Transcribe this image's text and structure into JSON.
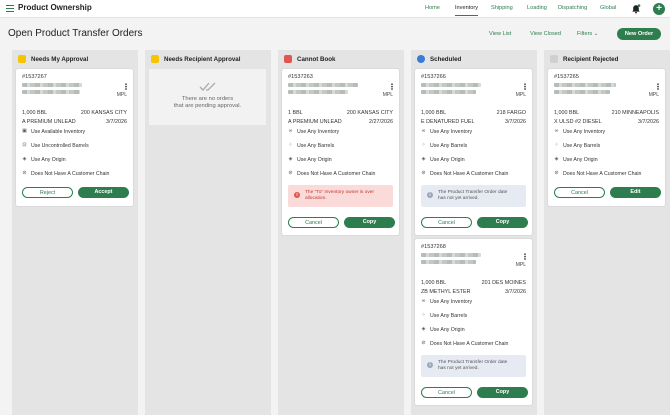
{
  "header": {
    "app_title": "Product Ownership",
    "nav": [
      "Home",
      "Inventory",
      "Shipping",
      "Loading",
      "Dispatching",
      "Global"
    ],
    "active_nav": "Inventory"
  },
  "page": {
    "title": "Open Product Transfer Orders",
    "view_list": "View List",
    "view_closed": "View Closed",
    "filters": "Filters",
    "new_order": "New Order"
  },
  "columns": {
    "needs_my_approval": {
      "title": "Needs My Approval",
      "cards": [
        {
          "order": "#1537267",
          "mpl": "MPL",
          "qty": "1,000 BBL",
          "dest": "200 KANSAS CITY",
          "product": "A PREMIUM UNLEAD",
          "date": "3/7/2026",
          "options": [
            "Use Available Inventory",
            "Use Uncontrolled Barrels",
            "Use Any Origin",
            "Does Not Have A Customer Chain"
          ],
          "btn_left": "Reject",
          "btn_right": "Accept"
        }
      ]
    },
    "needs_recipient_approval": {
      "title": "Needs Recipient Approval",
      "empty_line1": "There are no orders",
      "empty_line2": "that are pending approval."
    },
    "cannot_book": {
      "title": "Cannot Book",
      "cards": [
        {
          "order": "#1537263",
          "mpl": "MPL",
          "qty": "1 BBL",
          "dest": "200 KANSAS CITY",
          "product": "A PREMIUM UNLEAD",
          "date": "2/27/2026",
          "options": [
            "Use Any Inventory",
            "Use Any Barrels",
            "Use Any Origin",
            "Does Not Have A Customer Chain"
          ],
          "alert_line1": "The \"To\" Inventory owner is over",
          "alert_line2": "allocation.",
          "btn_left": "Cancel",
          "btn_right": "Copy"
        }
      ]
    },
    "scheduled": {
      "title": "Scheduled",
      "cards": [
        {
          "order": "#1537266",
          "mpl": "MPL",
          "qty": "1,000 BBL",
          "dest": "218 FARGO",
          "product": "E DENATURED FUEL",
          "date": "3/7/2026",
          "options": [
            "Use Any Inventory",
            "Use Any Barrels",
            "Use Any Origin",
            "Does Not Have A Customer Chain"
          ],
          "alert_line1": "The Product Transfer Order date",
          "alert_line2": "has not yet arrived.",
          "btn_left": "Cancel",
          "btn_right": "Copy"
        },
        {
          "order": "#1537268",
          "mpl": "MPL",
          "qty": "1,000 BBL",
          "dest": "201 DES MOINES",
          "product": "ZB METHYL ESTER",
          "date": "3/7/2026",
          "options": [
            "Use Any Inventory",
            "Use Any Barrels",
            "Use Any Origin",
            "Does Not Have A Customer Chain"
          ],
          "alert_line1": "The Product Transfer Order date",
          "alert_line2": "has not yet arrived.",
          "btn_left": "Cancel",
          "btn_right": "Copy"
        }
      ]
    },
    "recipient_rejected": {
      "title": "Recipient Rejected",
      "cards": [
        {
          "order": "#1537265",
          "mpl": "MPL",
          "qty": "1,000 BBL",
          "dest": "210 MINNEAPOLIS",
          "product": "X ULSD #2 DIESEL",
          "date": "3/7/2026",
          "options": [
            "Use Any Inventory",
            "Use Any Barrels",
            "Use Any Origin",
            "Does Not Have A Customer Chain"
          ],
          "btn_left": "Cancel",
          "btn_right": "Edit"
        }
      ]
    }
  },
  "colors": {
    "brand": "#2e7d4f",
    "approval": "#e6b400",
    "cannot": "#e0554f",
    "scheduled": "#3a7bd5",
    "rejected": "#bbbbbb"
  }
}
